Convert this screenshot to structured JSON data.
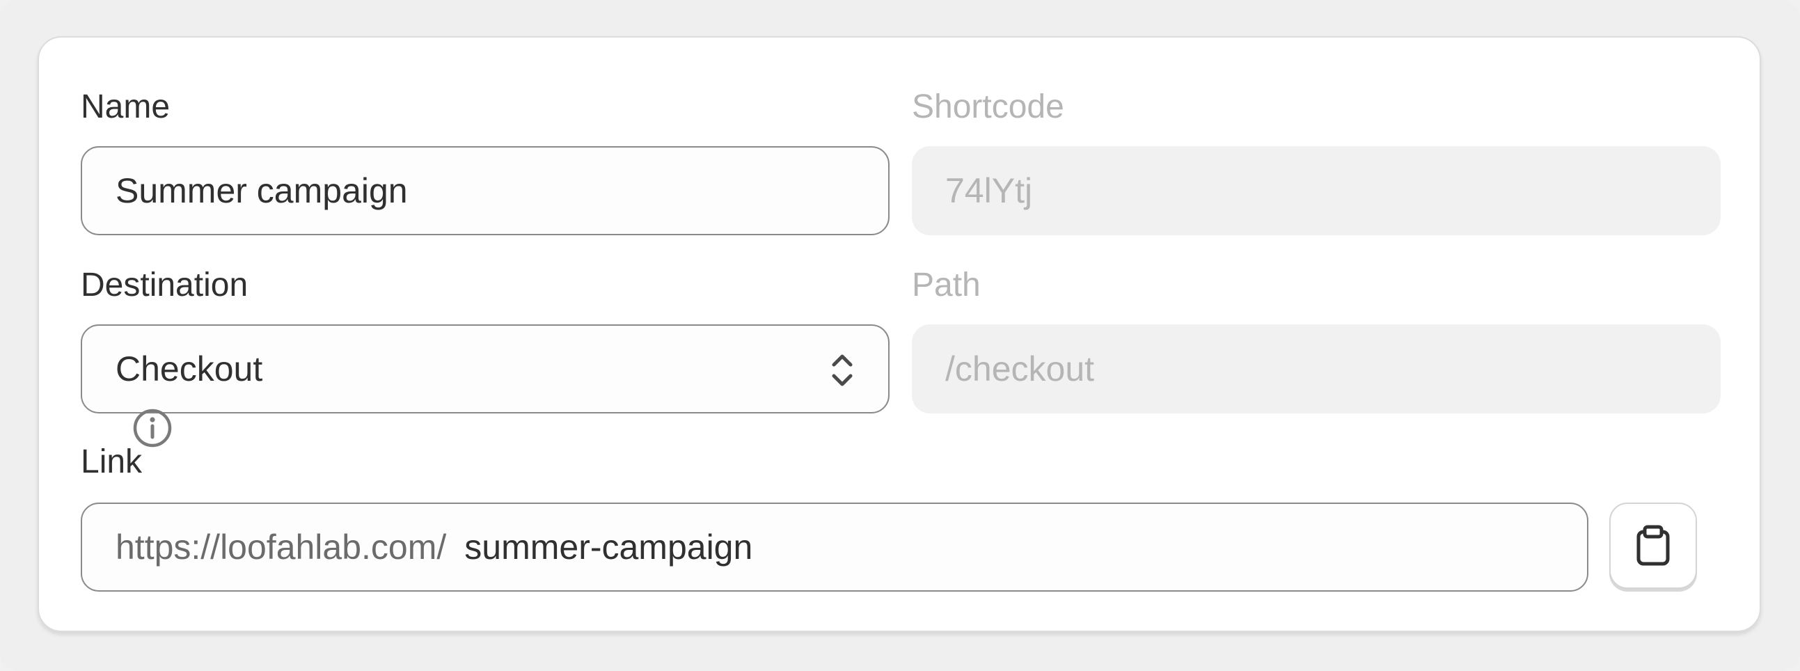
{
  "form": {
    "name_label": "Name",
    "name_value": "Summer campaign",
    "shortcode_label": "Shortcode",
    "shortcode_value": "74lYtj",
    "destination_label": "Destination",
    "destination_value": "Checkout",
    "path_label": "Path",
    "path_value": "/checkout",
    "link_label": "Link",
    "link_prefix": "https://loofahlab.com/",
    "link_slug": "summer-campaign"
  },
  "icons": {
    "info": "info-circle-icon",
    "select": "chevron-up-down-icon",
    "copy": "clipboard-icon"
  },
  "colors": {
    "text": "#303030",
    "muted": "#b5b5b5",
    "disabled_bg": "#f1f1f1",
    "border": "#8a8a8a"
  }
}
